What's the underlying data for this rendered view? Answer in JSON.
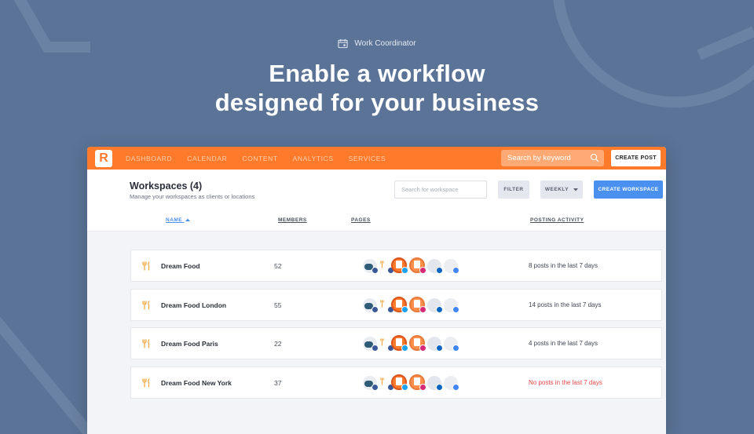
{
  "hero": {
    "label": "Work Coordinator",
    "title_line1": "Enable a workflow",
    "title_line2": "designed for your business"
  },
  "topbar": {
    "logo_letter": "R",
    "nav": [
      "DASHBOARD",
      "CALENDAR",
      "CONTENT",
      "ANALYTICS",
      "SERVICES"
    ],
    "search_placeholder": "Search by keyword",
    "create_post_label": "CREATE POST"
  },
  "workspaces": {
    "title": "Workspaces (4)",
    "subtitle": "Manage your workspaces as clients or locations",
    "search_placeholder": "Search for workspace",
    "filter_label": "FILTER",
    "period_label": "WEEKLY",
    "create_label": "CREATE WORKSPACE",
    "columns": {
      "name": "NAME",
      "members": "MEMBERS",
      "pages": "PAGES",
      "activity": "POSTING ACTIVITY"
    },
    "rows": [
      {
        "name": "Dream Food",
        "members": "52",
        "activity": "8 posts in the last 7 days",
        "alert": false
      },
      {
        "name": "Dream Food London",
        "members": "55",
        "activity": "14 posts in the last 7 days",
        "alert": false
      },
      {
        "name": "Dream Food Paris",
        "members": "22",
        "activity": "4 posts in the last 7 days",
        "alert": false
      },
      {
        "name": "Dream Food New York",
        "members": "37",
        "activity": "No posts in the last 7 days",
        "alert": true
      }
    ]
  },
  "colors": {
    "background": "#5a7396",
    "brand_orange": "#ff7a2a",
    "accent_blue": "#4a90f0",
    "alert_red": "#e94848"
  },
  "page_icons": [
    "kakao-facebook",
    "fork-facebook",
    "logo-twitter",
    "logo-instagram",
    "generic-linkedin",
    "generic-google"
  ]
}
